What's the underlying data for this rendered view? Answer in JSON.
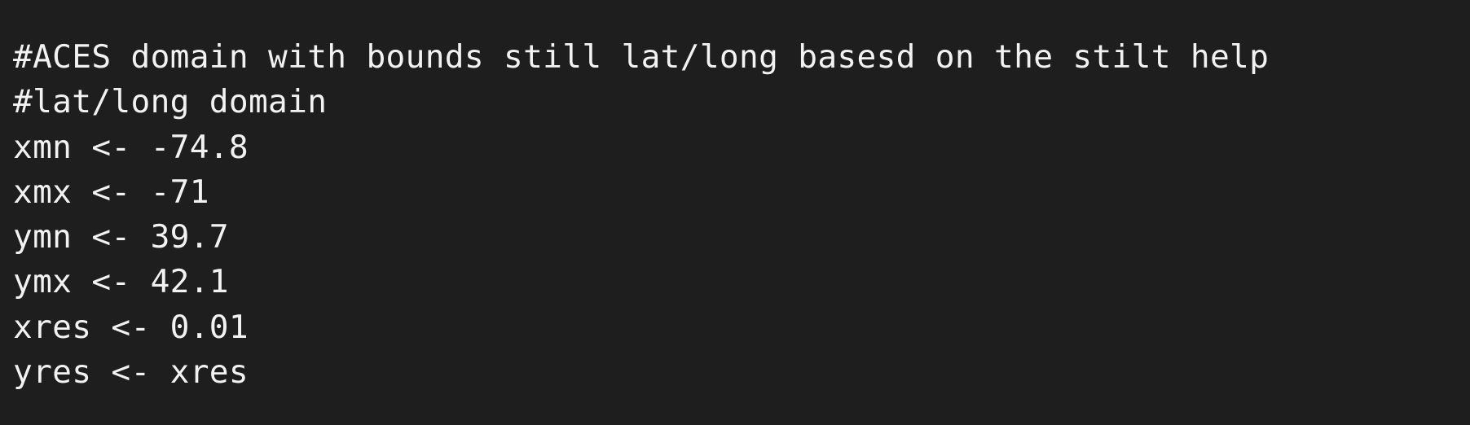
{
  "editor": {
    "background": "#1e1e1e",
    "text_color": "#f2f2f2",
    "lines": [
      "#ACES domain with bounds still lat/long basesd on the stilt help",
      "#lat/long domain",
      "xmn <- -74.8",
      "xmx <- -71",
      "ymn <- 39.7",
      "ymx <- 42.1",
      "xres <- 0.01",
      "yres <- xres"
    ]
  }
}
